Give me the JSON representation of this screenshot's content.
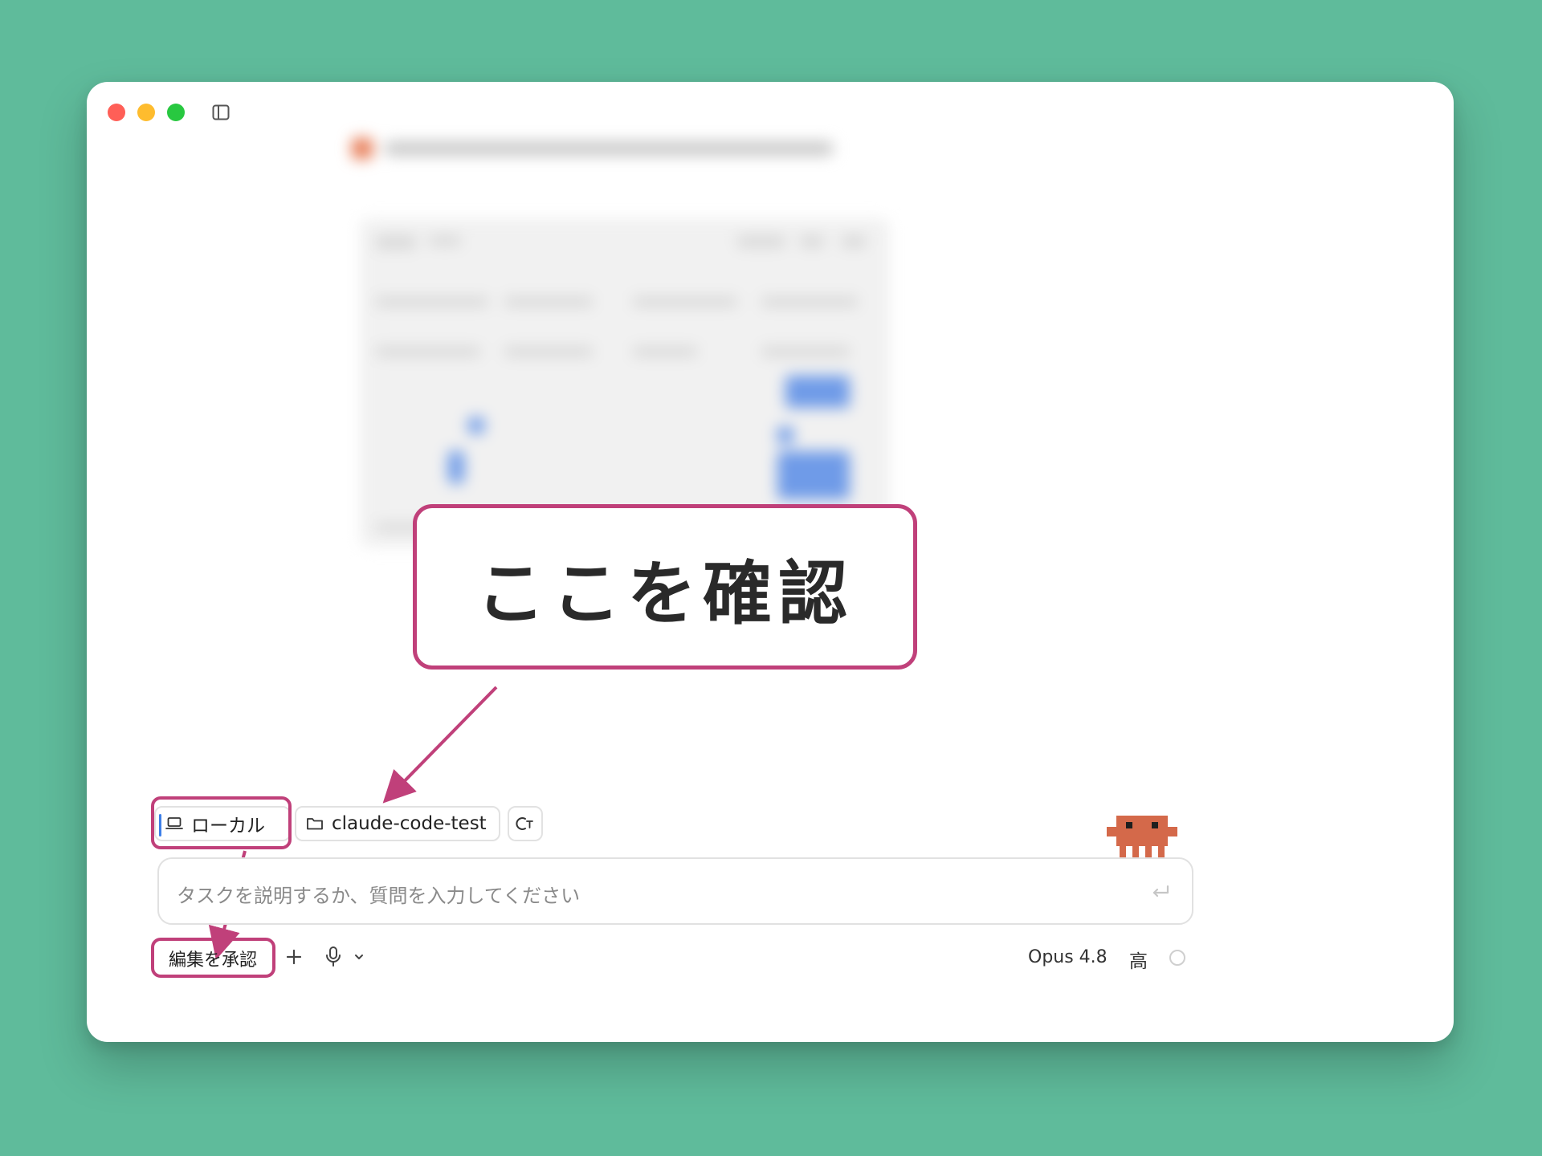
{
  "annotation": {
    "callout_text": "ここを確認",
    "accent_color": "#c0407a"
  },
  "window": {
    "controls": [
      "close",
      "minimize",
      "zoom"
    ],
    "sidebar_toggle_icon": "sidebar-icon"
  },
  "chips": {
    "environment_label": "ローカル",
    "environment_icon": "laptop-icon",
    "folder_label": "claude-code-test",
    "folder_icon": "folder-icon",
    "branch_icon": "branch-icon"
  },
  "composer": {
    "placeholder": "タスクを説明するか、質問を入力してください",
    "submit_icon": "enter-icon"
  },
  "toolbar": {
    "approve_label": "編集を承認",
    "plus_icon": "plus-icon",
    "mic_icon": "microphone-icon",
    "model_label": "Opus 4.8",
    "effort_label": "高"
  },
  "colors": {
    "background": "#5fbb9b",
    "mascot": "#d4694a",
    "caret": "#3d7fe8"
  }
}
